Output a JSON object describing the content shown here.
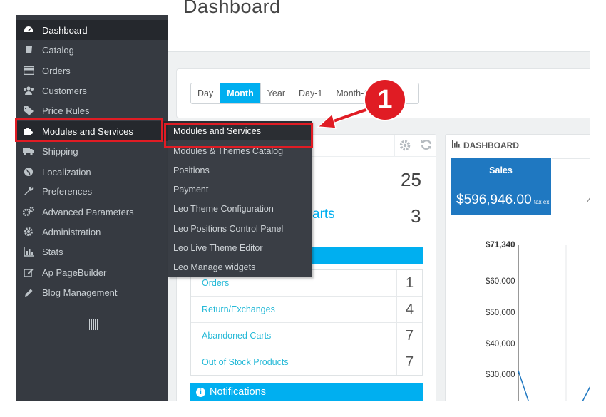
{
  "page": {
    "title": "Dashboard"
  },
  "sidebar": {
    "items": [
      {
        "label": "Dashboard",
        "icon": "dashboard-icon"
      },
      {
        "label": "Catalog",
        "icon": "book-icon"
      },
      {
        "label": "Orders",
        "icon": "credit-card-icon"
      },
      {
        "label": "Customers",
        "icon": "users-icon"
      },
      {
        "label": "Price Rules",
        "icon": "tags-icon"
      },
      {
        "label": "Modules and Services",
        "icon": "puzzle-icon"
      },
      {
        "label": "Shipping",
        "icon": "truck-icon"
      },
      {
        "label": "Localization",
        "icon": "globe-icon"
      },
      {
        "label": "Preferences",
        "icon": "wrench-icon"
      },
      {
        "label": "Advanced Parameters",
        "icon": "cogs-icon"
      },
      {
        "label": "Administration",
        "icon": "cog-icon"
      },
      {
        "label": "Stats",
        "icon": "bar-chart-icon"
      },
      {
        "label": "Ap PageBuilder",
        "icon": "edit-icon"
      },
      {
        "label": "Blog Management",
        "icon": "pencil-icon"
      }
    ]
  },
  "submenu": {
    "items": [
      "Modules and Services",
      "Modules & Themes Catalog",
      "Positions",
      "Payment",
      "Leo Theme Configuration",
      "Leo Positions Control Panel",
      "Leo Live Theme Editor",
      "Leo Manage widgets"
    ]
  },
  "filter": {
    "buttons": [
      "Day",
      "Month",
      "Year",
      "Day-1",
      "Month-1",
      ""
    ],
    "active": "Month"
  },
  "callout": {
    "number": "1"
  },
  "activity": {
    "big_value_1": "25",
    "carts_label": "arts",
    "big_value_2": "3",
    "rows": [
      {
        "label": "Orders",
        "value": "1"
      },
      {
        "label": "Return/Exchanges",
        "value": "4"
      },
      {
        "label": "Abandoned Carts",
        "value": "7"
      },
      {
        "label": "Out of Stock Products",
        "value": "7"
      }
    ],
    "notifications_label": "Notifications"
  },
  "dashboard": {
    "title": "DASHBOARD",
    "sales_label": "Sales",
    "sales_value": "$596,946.00",
    "sales_tax": "tax ex",
    "next_digit": "4",
    "chart_y_labels": [
      "$71,340",
      "$60,000",
      "$50,000",
      "$40,000",
      "$30,000"
    ]
  },
  "chart_data": {
    "type": "line",
    "yticks": [
      71340,
      60000,
      50000,
      40000,
      30000
    ],
    "ylim": [
      30000,
      71340
    ]
  },
  "colors": {
    "sidebar_bg": "#363a41",
    "accent_blue": "#00aff0",
    "sales_blue": "#1f78c1",
    "annotation_red": "#e01c24",
    "link_blue": "#25b9d7"
  }
}
